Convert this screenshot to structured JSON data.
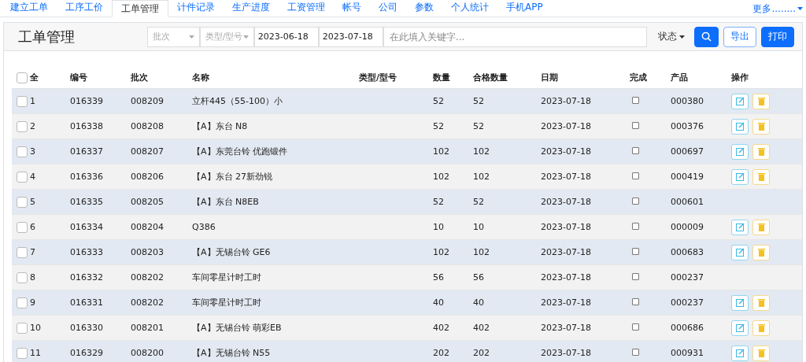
{
  "nav": {
    "tabs": [
      {
        "label": "建立工单",
        "selected": false
      },
      {
        "label": "工序工价",
        "selected": false
      },
      {
        "label": "工单管理",
        "selected": true
      },
      {
        "label": "计件记录",
        "selected": false
      },
      {
        "label": "生产进度",
        "selected": false
      },
      {
        "label": "工资管理",
        "selected": false
      },
      {
        "label": "帐号",
        "selected": false
      },
      {
        "label": "公司",
        "selected": false
      },
      {
        "label": "参数",
        "selected": false
      },
      {
        "label": "个人统计",
        "selected": false
      },
      {
        "label": "手机APP",
        "selected": false
      }
    ],
    "more": "更多........"
  },
  "panel": {
    "title": "工单管理",
    "batch_placeholder": "批次",
    "type_placeholder": "类型/型号",
    "date_from": "2023-06-18",
    "date_to": "2023-07-18",
    "search_placeholder": "在此填入关键字...",
    "status": "状态",
    "export": "导出",
    "print": "打印"
  },
  "table": {
    "select_all": {
      "label": "全",
      "checked": false
    },
    "columns": [
      "编号",
      "批次",
      "名称",
      "类型/型号",
      "数量",
      "合格数量",
      "日期",
      "完成",
      "产品",
      "操作"
    ],
    "rows": [
      {
        "index": "1",
        "code": "016339",
        "batch": "008209",
        "name": "立杆445（55-100）小",
        "type": "",
        "qty": "52",
        "ok_qty": "52",
        "date": "2023-07-18",
        "done": false,
        "product": "000380",
        "actions": true,
        "checked": false
      },
      {
        "index": "2",
        "code": "016338",
        "batch": "008208",
        "name": "【A】东台 N8",
        "type": "",
        "qty": "52",
        "ok_qty": "52",
        "date": "2023-07-18",
        "done": false,
        "product": "000376",
        "actions": true,
        "checked": false
      },
      {
        "index": "3",
        "code": "016337",
        "batch": "008207",
        "name": "【A】东莞台铃 优跑锻件",
        "type": "",
        "qty": "102",
        "ok_qty": "102",
        "date": "2023-07-18",
        "done": false,
        "product": "000697",
        "actions": true,
        "checked": false
      },
      {
        "index": "4",
        "code": "016336",
        "batch": "008206",
        "name": "【A】东台 27新劲锐",
        "type": "",
        "qty": "102",
        "ok_qty": "102",
        "date": "2023-07-18",
        "done": false,
        "product": "000419",
        "actions": true,
        "checked": false
      },
      {
        "index": "5",
        "code": "016335",
        "batch": "008205",
        "name": "【A】东台 N8EB",
        "type": "",
        "qty": "52",
        "ok_qty": "52",
        "date": "2023-07-18",
        "done": false,
        "product": "000601",
        "actions": false,
        "checked": false
      },
      {
        "index": "6",
        "code": "016334",
        "batch": "008204",
        "name": "Q386",
        "type": "",
        "qty": "10",
        "ok_qty": "10",
        "date": "2023-07-18",
        "done": false,
        "product": "000009",
        "actions": true,
        "checked": false
      },
      {
        "index": "7",
        "code": "016333",
        "batch": "008203",
        "name": "【A】无锡台铃 GE6",
        "type": "",
        "qty": "102",
        "ok_qty": "102",
        "date": "2023-07-18",
        "done": false,
        "product": "000683",
        "actions": true,
        "checked": false
      },
      {
        "index": "8",
        "code": "016332",
        "batch": "008202",
        "name": "车间零星计时工时",
        "type": "",
        "qty": "56",
        "ok_qty": "56",
        "date": "2023-07-18",
        "done": false,
        "product": "000237",
        "actions": false,
        "checked": false
      },
      {
        "index": "9",
        "code": "016331",
        "batch": "008202",
        "name": "车间零星计时工时",
        "type": "",
        "qty": "40",
        "ok_qty": "40",
        "date": "2023-07-18",
        "done": false,
        "product": "000237",
        "actions": true,
        "checked": false
      },
      {
        "index": "10",
        "code": "016330",
        "batch": "008201",
        "name": "【A】无锡台铃 萌彩EB",
        "type": "",
        "qty": "402",
        "ok_qty": "402",
        "date": "2023-07-18",
        "done": false,
        "product": "000686",
        "actions": true,
        "checked": false
      },
      {
        "index": "11",
        "code": "016329",
        "batch": "008200",
        "name": "【A】无锡台铃 N55",
        "type": "",
        "qty": "202",
        "ok_qty": "202",
        "date": "2023-07-18",
        "done": false,
        "product": "000931",
        "actions": true,
        "checked": false
      }
    ]
  }
}
